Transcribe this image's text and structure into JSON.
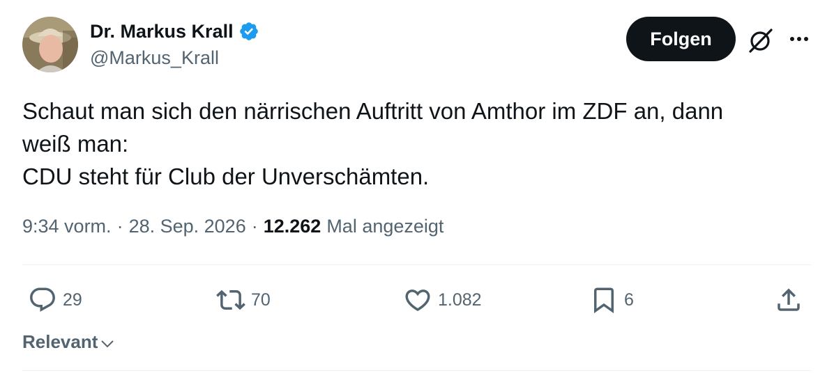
{
  "author": {
    "name": "Dr. Markus Krall",
    "handle": "@Markus_Krall",
    "verified": true,
    "verified_color": "#1d9bf0",
    "avatar_icon": "avatar-photo"
  },
  "header": {
    "follow_label": "Folgen",
    "grok_icon": "grok-icon",
    "more_icon": "more-icon"
  },
  "tweet": {
    "text": "Schaut man sich den närrischen Auftritt von Amthor im ZDF an, dann\nweiß man:\nCDU steht für Club der Unverschämten."
  },
  "meta": {
    "time": "9:34 vorm.",
    "sep1": "·",
    "date": "28. Sep. 2026",
    "sep2": "·",
    "views": "12.262",
    "views_label": "Mal angezeigt"
  },
  "actions": {
    "replies": "29",
    "reposts": "70",
    "likes": "1.082",
    "bookmarks": "6"
  },
  "sort": {
    "label": "Relevant"
  },
  "colors": {
    "text": "#0f1419",
    "secondary": "#536471",
    "divider": "#eff3f4",
    "button_bg": "#0f1419"
  }
}
